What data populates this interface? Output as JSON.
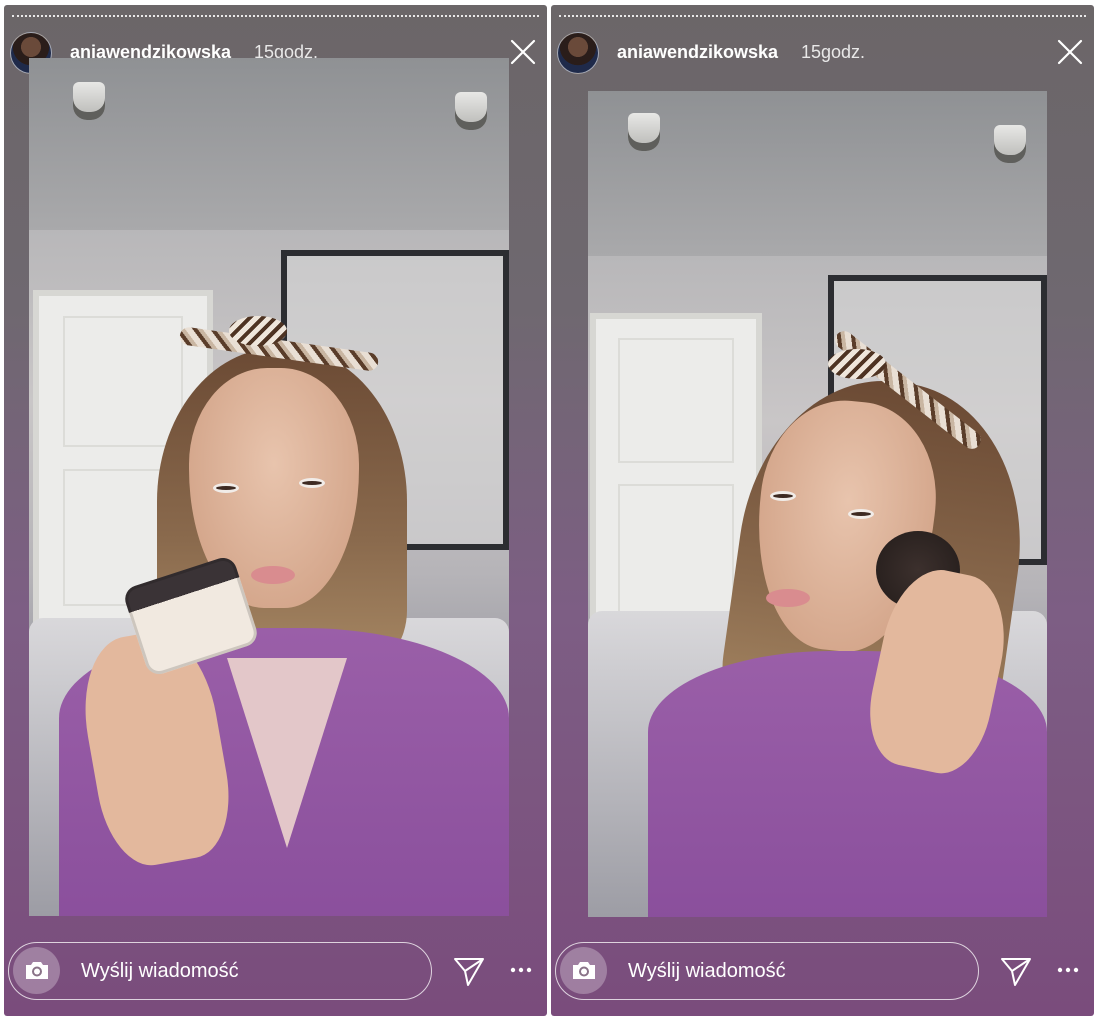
{
  "stories": [
    {
      "username": "aniawendzikowska",
      "time": "15godz.",
      "message_placeholder": "Wyślij wiadomość",
      "icons": {
        "close": "close-icon",
        "camera": "camera-icon",
        "send": "send-icon",
        "more": "more-icon"
      }
    },
    {
      "username": "aniawendzikowska",
      "time": "15godz.",
      "message_placeholder": "Wyślij wiadomość",
      "icons": {
        "close": "close-icon",
        "camera": "camera-icon",
        "send": "send-icon",
        "more": "more-icon"
      }
    }
  ],
  "colors": {
    "text": "#ffffff",
    "sweater": "#9a5fa8",
    "background_bottom": "#7a4c7c"
  }
}
